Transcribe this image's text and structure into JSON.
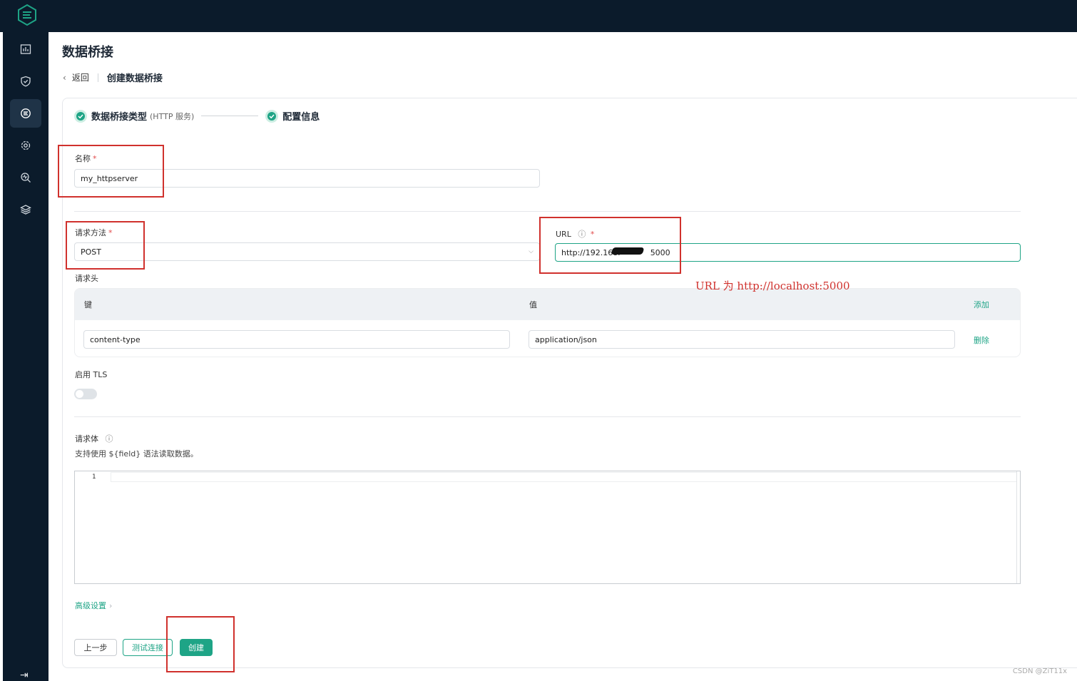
{
  "page": {
    "title": "数据桥接"
  },
  "breadcrumb": {
    "back_label": "返回",
    "current": "创建数据桥接"
  },
  "steps": [
    {
      "title": "数据桥接类型",
      "sub": "(HTTP 服务)"
    },
    {
      "title": "配置信息",
      "sub": ""
    }
  ],
  "form": {
    "name_label": "名称",
    "name_value": "my_httpserver",
    "method_label": "请求方法",
    "method_value": "POST",
    "url_label": "URL",
    "url_value": "http://192.168.",
    "url_value_tail": "5000",
    "headers_label": "请求头",
    "headers": {
      "key_col": "键",
      "value_col": "值",
      "add_label": "添加",
      "rows": [
        {
          "key": "content-type",
          "value": "application/json",
          "action": "删除"
        }
      ]
    },
    "tls_label": "启用 TLS",
    "tls_enabled": false,
    "body_label": "请求体",
    "body_hint": "支持使用 ${field} 语法读取数据。",
    "body_line_number": "1",
    "advanced_label": "高级设置",
    "required_mark": "*"
  },
  "buttons": {
    "prev": "上一步",
    "test": "测试连接",
    "create": "创建"
  },
  "annotation": "URL 为 http://localhost:5000",
  "watermark": "CSDN @ZiT11x",
  "colors": {
    "accent": "#1ea486",
    "sidebar": "#0b1b2b",
    "annotation": "#d0312d"
  }
}
